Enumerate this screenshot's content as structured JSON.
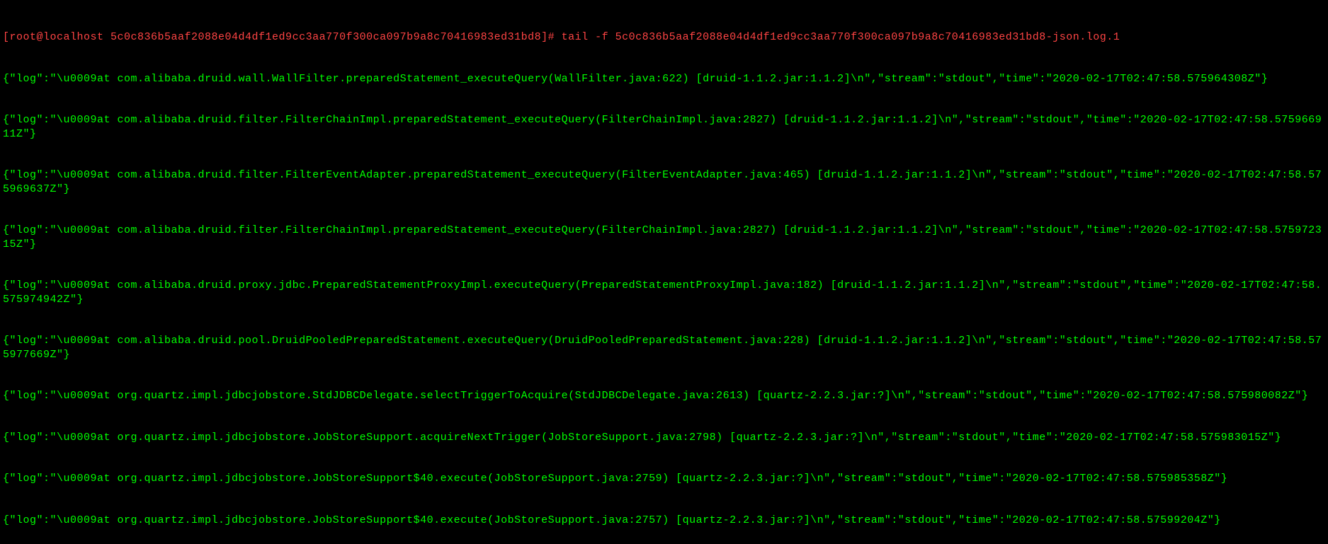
{
  "prompt": "[root@localhost 5c0c836b5aaf2088e04d4df1ed9cc3aa770f300ca097b9a8c70416983ed31bd8]# tail -f 5c0c836b5aaf2088e04d4df1ed9cc3aa770f300ca097b9a8c70416983ed31bd8-json.log.1",
  "logs": [
    "{\"log\":\"\\u0009at com.alibaba.druid.wall.WallFilter.preparedStatement_executeQuery(WallFilter.java:622) [druid-1.1.2.jar:1.1.2]\\n\",\"stream\":\"stdout\",\"time\":\"2020-02-17T02:47:58.575964308Z\"}",
    "{\"log\":\"\\u0009at com.alibaba.druid.filter.FilterChainImpl.preparedStatement_executeQuery(FilterChainImpl.java:2827) [druid-1.1.2.jar:1.1.2]\\n\",\"stream\":\"stdout\",\"time\":\"2020-02-17T02:47:58.575966911Z\"}",
    "{\"log\":\"\\u0009at com.alibaba.druid.filter.FilterEventAdapter.preparedStatement_executeQuery(FilterEventAdapter.java:465) [druid-1.1.2.jar:1.1.2]\\n\",\"stream\":\"stdout\",\"time\":\"2020-02-17T02:47:58.575969637Z\"}",
    "{\"log\":\"\\u0009at com.alibaba.druid.filter.FilterChainImpl.preparedStatement_executeQuery(FilterChainImpl.java:2827) [druid-1.1.2.jar:1.1.2]\\n\",\"stream\":\"stdout\",\"time\":\"2020-02-17T02:47:58.575972315Z\"}",
    "{\"log\":\"\\u0009at com.alibaba.druid.proxy.jdbc.PreparedStatementProxyImpl.executeQuery(PreparedStatementProxyImpl.java:182) [druid-1.1.2.jar:1.1.2]\\n\",\"stream\":\"stdout\",\"time\":\"2020-02-17T02:47:58.575974942Z\"}",
    "{\"log\":\"\\u0009at com.alibaba.druid.pool.DruidPooledPreparedStatement.executeQuery(DruidPooledPreparedStatement.java:228) [druid-1.1.2.jar:1.1.2]\\n\",\"stream\":\"stdout\",\"time\":\"2020-02-17T02:47:58.575977669Z\"}",
    "{\"log\":\"\\u0009at org.quartz.impl.jdbcjobstore.StdJDBCDelegate.selectTriggerToAcquire(StdJDBCDelegate.java:2613) [quartz-2.2.3.jar:?]\\n\",\"stream\":\"stdout\",\"time\":\"2020-02-17T02:47:58.575980082Z\"}",
    "{\"log\":\"\\u0009at org.quartz.impl.jdbcjobstore.JobStoreSupport.acquireNextTrigger(JobStoreSupport.java:2798) [quartz-2.2.3.jar:?]\\n\",\"stream\":\"stdout\",\"time\":\"2020-02-17T02:47:58.575983015Z\"}",
    "{\"log\":\"\\u0009at org.quartz.impl.jdbcjobstore.JobStoreSupport$40.execute(JobStoreSupport.java:2759) [quartz-2.2.3.jar:?]\\n\",\"stream\":\"stdout\",\"time\":\"2020-02-17T02:47:58.575985358Z\"}",
    "{\"log\":\"\\u0009at org.quartz.impl.jdbcjobstore.JobStoreSupport$40.execute(JobStoreSupport.java:2757) [quartz-2.2.3.jar:?]\\n\",\"stream\":\"stdout\",\"time\":\"2020-02-17T02:47:58.57599204Z\"}"
  ]
}
